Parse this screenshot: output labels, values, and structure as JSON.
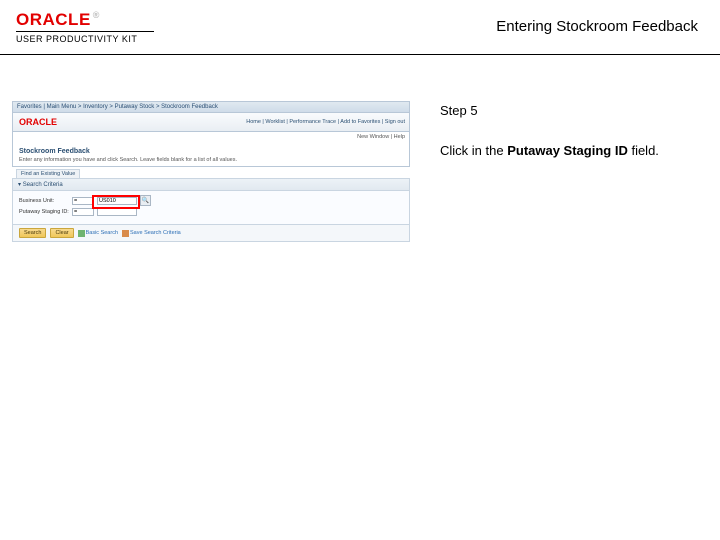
{
  "header": {
    "brand": "ORACLE",
    "tm": "®",
    "subbrand": "USER PRODUCTIVITY KIT",
    "page_title": "Entering Stockroom Feedback"
  },
  "instructions": {
    "step_label": "Step 5",
    "text_prefix": "Click in the ",
    "text_bold": "Putaway Staging ID",
    "text_suffix": " field."
  },
  "mock": {
    "breadcrumb": "Favorites  |  Main Menu  >  Inventory  >  Putaway Stock  >  Stockroom Feedback",
    "brand": "ORACLE",
    "nav": "Home  |  Worklist  |  Performance Trace  |  Add to Favorites  |  Sign out",
    "status_line": "New Window | Help",
    "section_title": "Stockroom Feedback",
    "section_desc": "Enter any information you have and click Search. Leave fields blank for a list of all values.",
    "tab_find": "Find an Existing Value",
    "panel_header": "Search Criteria",
    "form": {
      "bu_label": "Business Unit:",
      "bu_op": "=",
      "bu_value": "US010",
      "staging_label": "Putaway Staging ID:",
      "staging_op": "=",
      "staging_value": ""
    },
    "buttons": {
      "search": "Search",
      "clear": "Clear",
      "basic": "Basic Search",
      "save": "Save Search Criteria"
    }
  }
}
